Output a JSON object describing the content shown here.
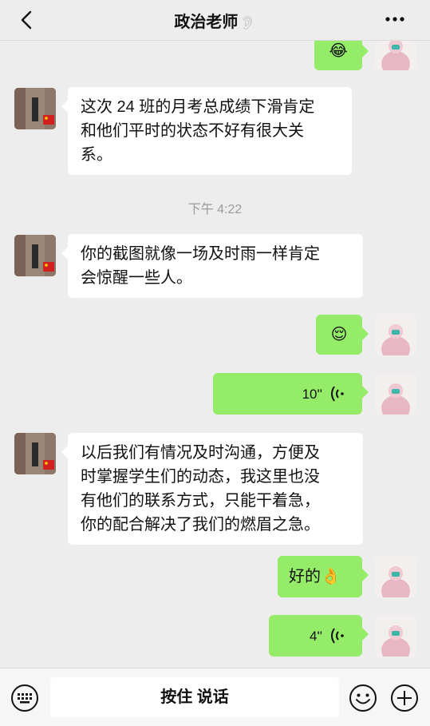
{
  "header": {
    "title": "政治老师",
    "back_icon": "chevron-left-icon",
    "mute_icon": "ear-icon",
    "more_icon": "more-dots-icon"
  },
  "messages": [
    {
      "side": "right",
      "type": "emoji",
      "content": "😂"
    },
    {
      "side": "left",
      "type": "text",
      "lines": [
        "这次 24 班的月考总成绩下滑肯定",
        "和他们平时的状态不好有很大关",
        "系。"
      ]
    },
    {
      "side": "center",
      "type": "time",
      "content": "下午 4:22"
    },
    {
      "side": "left",
      "type": "text",
      "lines": [
        "你的截图就像一场及时雨一样肯定",
        "会惊醒一些人。"
      ]
    },
    {
      "side": "right",
      "type": "emoji",
      "content": "😌"
    },
    {
      "side": "right",
      "type": "voice",
      "content": "10''"
    },
    {
      "side": "left",
      "type": "text",
      "lines": [
        "以后我们有情况及时沟通，方便及",
        "时掌握学生们的动态，我这里也没",
        "有他们的联系方式，只能干着急，",
        "你的配合解决了我们的燃眉之急。"
      ]
    },
    {
      "side": "right",
      "type": "text",
      "content": "好的👌"
    },
    {
      "side": "right",
      "type": "voice",
      "content": "4''"
    }
  ],
  "input_bar": {
    "hold_to_talk": "按住 说话",
    "keyboard_icon": "keyboard-icon",
    "emoji_icon": "smiley-icon",
    "plus_icon": "plus-circle-icon"
  },
  "colors": {
    "background": "#ededed",
    "bubble_self": "#95ec69",
    "bubble_other": "#ffffff"
  }
}
